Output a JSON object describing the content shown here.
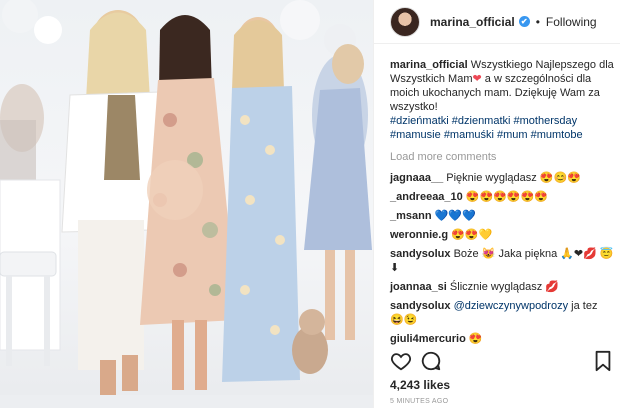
{
  "post": {
    "username": "marina_official",
    "verified_mark": "✔",
    "separator": "•",
    "follow_status": "Following",
    "caption_user": "marina_official",
    "caption_text": "Wszystkiego Najlepszego dla Wszystkich Mam",
    "caption_heart": "❤",
    "caption_text2": " a w szczególności dla moich ukochanych mam. Dziękuję Wam za wszystko!",
    "hashtags": [
      "#dzieńmatki",
      "#dzienmatki",
      "#mothersday",
      "#mamusie",
      "#mamuśki",
      "#mum",
      "#mumtobe"
    ],
    "load_more": "Load more comments",
    "likes": "4,243 likes",
    "time": "5 MINUTES AGO"
  },
  "comments": [
    {
      "user": "jagnaaa__",
      "text": "Pięknie wyglądasz 😍😊😍"
    },
    {
      "user": "_andreeaa_10",
      "text": "😍😍😍😍😍😍"
    },
    {
      "user": "_msann",
      "text": "💙💙💙"
    },
    {
      "user": "weronnie.g",
      "text": "😍😍💛"
    },
    {
      "user": "sandysolux",
      "text": "Boże 😻 Jaka piękna 🙏❤💋 😇⬇"
    },
    {
      "user": "joannaa_si",
      "text": "Ślicznie wyglądasz 💋"
    },
    {
      "user": "sandysolux",
      "mention": "@dziewczynywpodrozy",
      "text": " ja tez 😆😉"
    },
    {
      "user": "giuli4mercurio",
      "text": "😍"
    }
  ],
  "icons": {
    "heart": "heart-icon",
    "comment": "comment-icon",
    "bookmark": "bookmark-icon",
    "verified": "verified-badge-icon"
  },
  "colors": {
    "link_blue": "#003569",
    "verified_blue": "#3897f0",
    "muted": "#999999",
    "heart_red": "#ed4956"
  }
}
